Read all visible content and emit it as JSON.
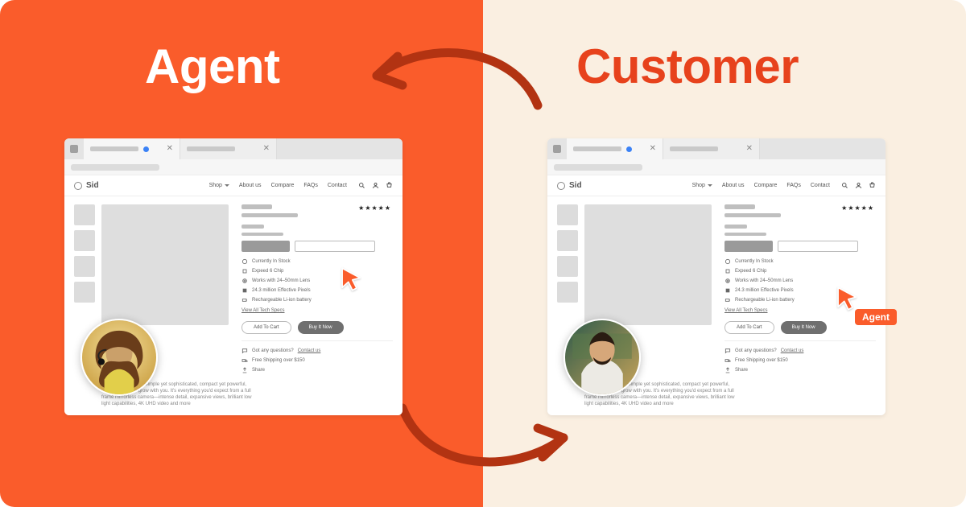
{
  "titles": {
    "agent": "Agent",
    "customer": "Customer"
  },
  "cursor_tag": "Agent",
  "site": {
    "brand": "Sid",
    "nav": {
      "shop": "Shop",
      "about": "About us",
      "compare": "Compare",
      "faqs": "FAQs",
      "contact": "Contact"
    }
  },
  "product": {
    "stars": "★★★★★",
    "features": {
      "stock": "Currently In Stock",
      "chip": "Expeed 6 Chip",
      "lens": "Works with 24–50mm Lens",
      "pixels": "24.3 million Effective Pixels",
      "battery": "Rechargeable Li-ion battery"
    },
    "tech_specs": "View All Tech Specs",
    "cta": {
      "add": "Add To Cart",
      "buy": "Buy It Now"
    },
    "meta": {
      "questions": "Got any questions?",
      "contact": "Contact us",
      "shipping": "Free Shipping over $150",
      "share": "Share"
    },
    "description": "begins with the Z 5. Simple yet sophisticated, compact yet powerful, the Z 5 is built to grow with you. It's everything you'd expect from a full frame mirrorless camera—intense detail, expansive views, brilliant low light capabilities, 4K UHD video and more"
  }
}
